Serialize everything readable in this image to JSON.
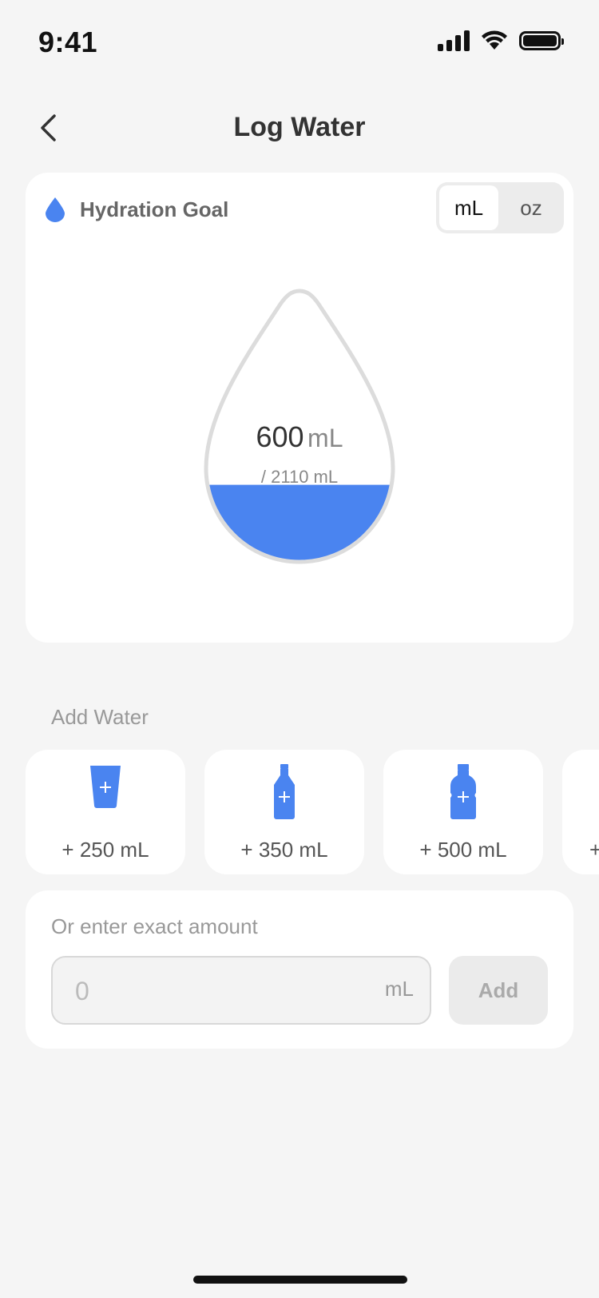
{
  "status_bar": {
    "time": "9:41"
  },
  "header": {
    "title": "Log Water"
  },
  "goal": {
    "title": "Hydration Goal",
    "units": [
      {
        "label": "mL",
        "active": true
      },
      {
        "label": "oz",
        "active": false
      }
    ],
    "current_value": "600",
    "current_unit": "mL",
    "goal_text": "/ 2110 mL",
    "progress_fraction": 0.2844,
    "accent_color": "#4a84f0"
  },
  "add_water": {
    "label": "Add Water",
    "options": [
      {
        "label": "+ 250 mL",
        "icon": "cup-icon"
      },
      {
        "label": "+ 350 mL",
        "icon": "bottle-icon"
      },
      {
        "label": "+ 500 mL",
        "icon": "large-bottle-icon"
      },
      {
        "label": "+",
        "icon": "more-icon"
      }
    ]
  },
  "exact": {
    "label": "Or enter exact amount",
    "placeholder": "0",
    "unit": "mL",
    "button_label": "Add"
  }
}
